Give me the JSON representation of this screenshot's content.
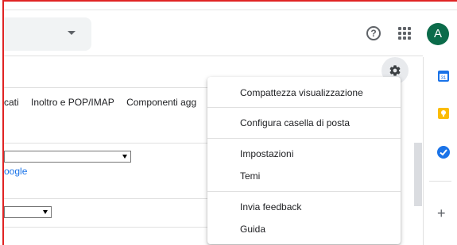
{
  "header": {
    "help_icon": "help-icon",
    "apps_icon": "apps-grid-icon",
    "avatar_initial": "A",
    "avatar_color": "#0b6b4a"
  },
  "settings": {
    "gear_icon": "gear-icon"
  },
  "tabs": [
    {
      "label": "cati"
    },
    {
      "label": "Inoltro e POP/IMAP"
    },
    {
      "label": "Componenti agg"
    }
  ],
  "content": {
    "link_text": "oogle"
  },
  "menu": {
    "items": [
      {
        "label": "Compattezza visualizzazione"
      },
      {
        "label": "Configura casella di posta"
      },
      {
        "label": "Impostazioni"
      },
      {
        "label": "Temi"
      },
      {
        "label": "Invia feedback"
      },
      {
        "label": "Guida"
      }
    ]
  },
  "side_panel": {
    "icons": [
      "calendar-icon",
      "keep-icon",
      "tasks-icon"
    ],
    "add_label": "+"
  }
}
